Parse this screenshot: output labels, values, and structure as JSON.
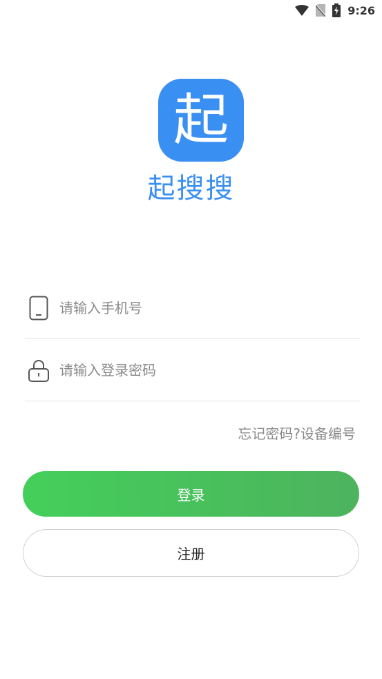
{
  "status_bar": {
    "time": "9:26",
    "icons": [
      "wifi-icon",
      "no-sim-icon",
      "battery-charging-icon"
    ]
  },
  "app": {
    "logo_char": "起",
    "name": "起搜搜",
    "brand_color": "#3a8ff2"
  },
  "form": {
    "phone": {
      "icon": "phone-icon",
      "placeholder": "请输入手机号",
      "value": ""
    },
    "password": {
      "icon": "lock-icon",
      "placeholder": "请输入登录密码",
      "value": ""
    }
  },
  "links": {
    "forgot_password": "忘记密码?",
    "device_id": "设备编号"
  },
  "buttons": {
    "login": "登录",
    "register": "注册",
    "login_color": "#4cc35c"
  }
}
